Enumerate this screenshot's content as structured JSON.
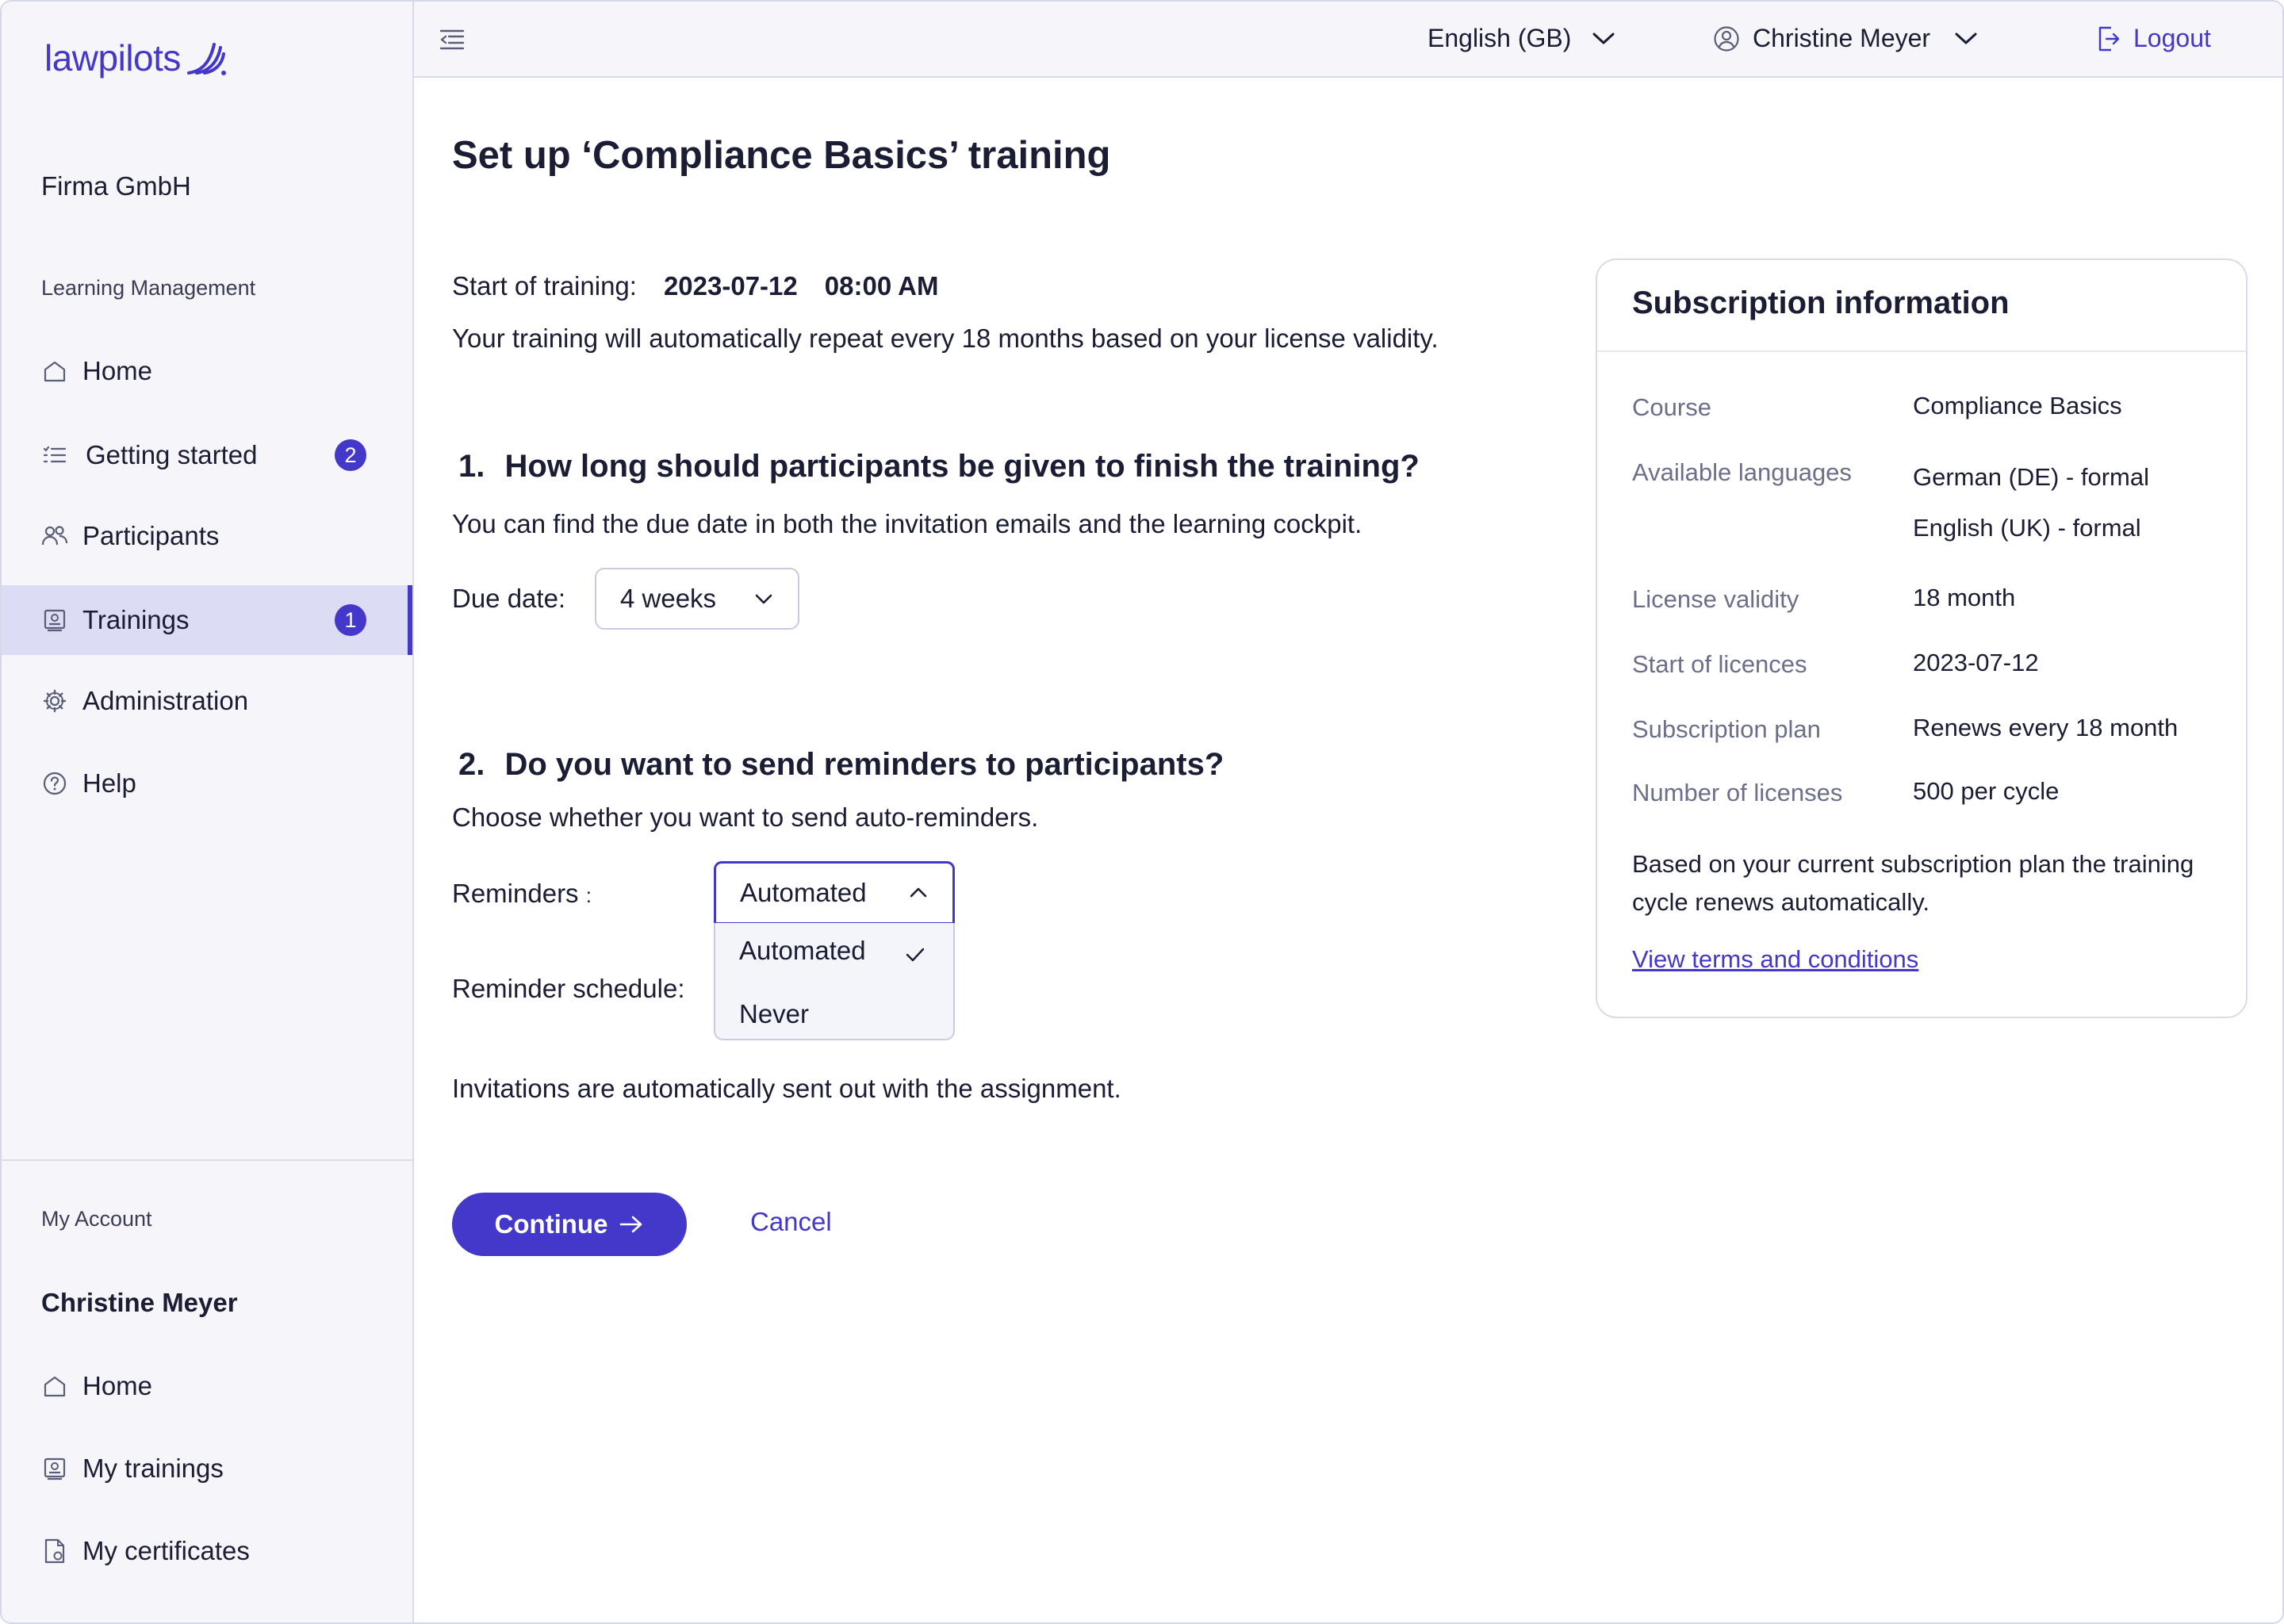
{
  "app": {
    "logo_text": "lawpilots",
    "company": "Firma GmbH"
  },
  "sidebar": {
    "section_learning": "Learning Management",
    "items": [
      {
        "label": "Home",
        "icon": "home-icon"
      },
      {
        "label": "Getting started",
        "icon": "checklist-icon",
        "badge": "2"
      },
      {
        "label": "Participants",
        "icon": "users-icon"
      },
      {
        "label": "Trainings",
        "icon": "training-icon",
        "badge": "1",
        "active": true
      },
      {
        "label": "Administration",
        "icon": "gear-icon"
      },
      {
        "label": "Help",
        "icon": "help-icon"
      }
    ],
    "section_account": "My Account",
    "account_name": "Christine Meyer",
    "account_items": [
      {
        "label": "Home",
        "icon": "home-icon"
      },
      {
        "label": "My trainings",
        "icon": "training-icon"
      },
      {
        "label": "My certificates",
        "icon": "certificate-icon"
      }
    ]
  },
  "topbar": {
    "language": "English (GB)",
    "user": "Christine Meyer",
    "logout": "Logout"
  },
  "main": {
    "title": "Set up ‘Compliance Basics’ training",
    "start_label": "Start of training:",
    "start_date": "2023-07-12",
    "start_time": "08:00 AM",
    "repeat_note": "Your training will automatically repeat every 18 months based on your license validity.",
    "q1": {
      "number": "1.",
      "title": "How long should participants be given to finish the training?",
      "desc": "You can find the due date in both the invitation emails and the learning cockpit.",
      "due_label": "Due date:",
      "due_value": "4 weeks"
    },
    "q2": {
      "number": "2.",
      "title": "Do you want to send reminders to participants?",
      "desc": "Choose whether you want to send auto-reminders.",
      "reminders_label": "Reminders",
      "reminders_colon": ":",
      "reminders_value": "Automated",
      "options": [
        "Automated",
        "Never"
      ],
      "schedule_label": "Reminder schedule:"
    },
    "invite_note": "Invitations are automatically sent out with the assignment.",
    "continue": "Continue",
    "cancel": "Cancel"
  },
  "subscription": {
    "title": "Subscription information",
    "rows": [
      {
        "key": "Course",
        "value": "Compliance Basics"
      },
      {
        "key": "Available languages",
        "value": "German (DE) - formal",
        "value2": "English (UK) - formal"
      },
      {
        "key": "License validity",
        "value": "18 month"
      },
      {
        "key": "Start of licences",
        "value": "2023-07-12"
      },
      {
        "key": "Subscription plan",
        "value": "Renews every 18 month"
      },
      {
        "key": "Number of licenses",
        "value": "500 per cycle"
      }
    ],
    "note": "Based on your current subscription plan the training cycle renews automatically.",
    "link": "View terms and conditions"
  },
  "colors": {
    "accent": "#4338ca",
    "sidebar_bg": "#f6f6fa",
    "active_bg": "#dcdcf5",
    "text": "#1a1d33",
    "muted": "#6b6f8a"
  }
}
